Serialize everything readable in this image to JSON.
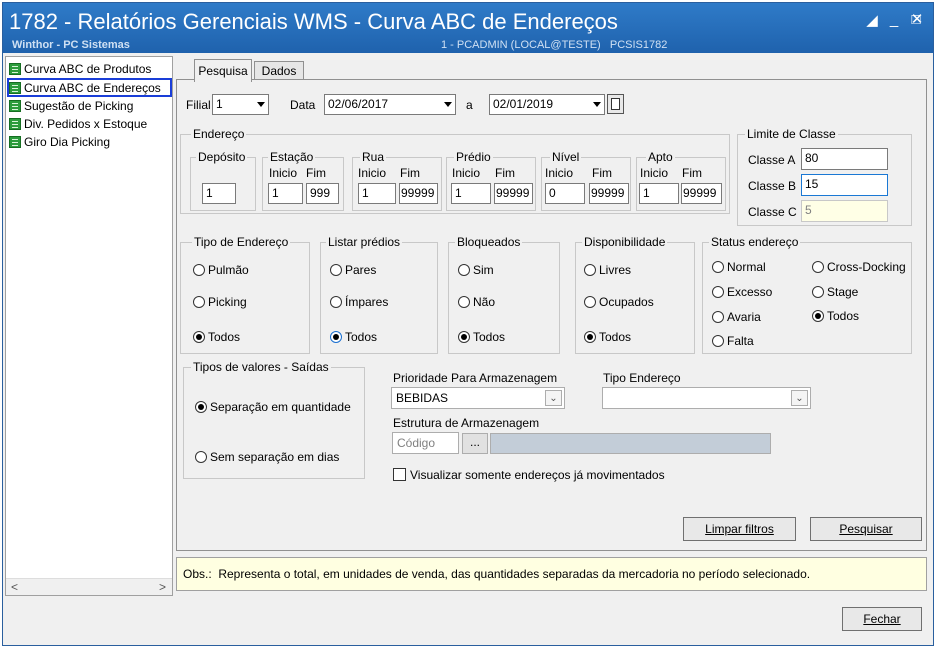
{
  "window": {
    "title": "1782 - Relatórios Gerenciais WMS - Curva ABC de Endereços",
    "subtitle": "Winthor - PC Sistemas",
    "session": "1 - PCADMIN (LOCAL@TESTE)   PCSIS1782",
    "accent": "#1f62ad"
  },
  "sidebar": {
    "items": [
      {
        "label": "Curva ABC de Produtos"
      },
      {
        "label": "Curva ABC de Endereços"
      },
      {
        "label": "Sugestão de Picking"
      },
      {
        "label": "Div. Pedidos x Estoque"
      },
      {
        "label": "Giro Dia Picking"
      }
    ],
    "scroll_left": "<",
    "scroll_right": ">"
  },
  "tabs": {
    "pesquisa": "Pesquisa",
    "dados": "Dados"
  },
  "filters": {
    "filial_label": "Filial",
    "filial_value": "1",
    "data_label": "Data",
    "data_inicio": "02/06/2017",
    "a_label": "a",
    "data_fim": "02/01/2019"
  },
  "endereco": {
    "title": "Endereço",
    "deposito": {
      "title": "Depósito",
      "value": "1"
    },
    "inicio_label": "Inicio",
    "fim_label": "Fim",
    "estacao": {
      "title": "Estação",
      "inicio": "1",
      "fim": "999"
    },
    "rua": {
      "title": "Rua",
      "inicio": "1",
      "fim": "99999"
    },
    "predio": {
      "title": "Prédio",
      "inicio": "1",
      "fim": "99999"
    },
    "nivel": {
      "title": "Nível",
      "inicio": "0",
      "fim": "99999"
    },
    "apto": {
      "title": "Apto",
      "inicio": "1",
      "fim": "99999"
    }
  },
  "limite": {
    "title": "Limite de Classe",
    "classe_a_label": "Classe A",
    "classe_a": "80",
    "classe_b_label": "Classe B",
    "classe_b": "15",
    "classe_c_label": "Classe C",
    "classe_c": "5"
  },
  "tipo_endereco": {
    "title": "Tipo de Endereço",
    "options": [
      "Pulmão",
      "Picking",
      "Todos"
    ],
    "selected": "Todos"
  },
  "listar_predios": {
    "title": "Listar prédios",
    "options": [
      "Pares",
      "Ímpares",
      "Todos"
    ],
    "selected": "Todos"
  },
  "bloqueados": {
    "title": "Bloqueados",
    "options": [
      "Sim",
      "Não",
      "Todos"
    ],
    "selected": "Todos"
  },
  "disponibilidade": {
    "title": "Disponibilidade",
    "options": [
      "Livres",
      "Ocupados",
      "Todos"
    ],
    "selected": "Todos"
  },
  "status": {
    "title": "Status endereço",
    "options": [
      "Normal",
      "Cross-Docking",
      "Excesso",
      "Stage",
      "Avaria",
      "Todos",
      "Falta"
    ],
    "selected": "Todos"
  },
  "tipos_valores": {
    "title": "Tipos de valores - Saídas",
    "options": [
      "Separação em quantidade",
      "Sem separação em dias"
    ],
    "selected": "Separação em quantidade"
  },
  "prioridade": {
    "label": "Prioridade Para Armazenagem",
    "value": "BEBIDAS"
  },
  "tipo_end_combo": {
    "label": "Tipo Endereço",
    "value": ""
  },
  "estrutura": {
    "label": "Estrutura de Armazenagem",
    "placeholder": "Código",
    "button": "..."
  },
  "visualizar": {
    "label": "Visualizar somente endereços já movimentados",
    "checked": false
  },
  "buttons": {
    "limpar": "Limpar filtros",
    "pesquisar": "Pesquisar",
    "fechar": "Fechar"
  },
  "obs": "Obs.:  Representa o total, em unidades de venda, das quantidades separadas da mercadoria no período selecionado."
}
